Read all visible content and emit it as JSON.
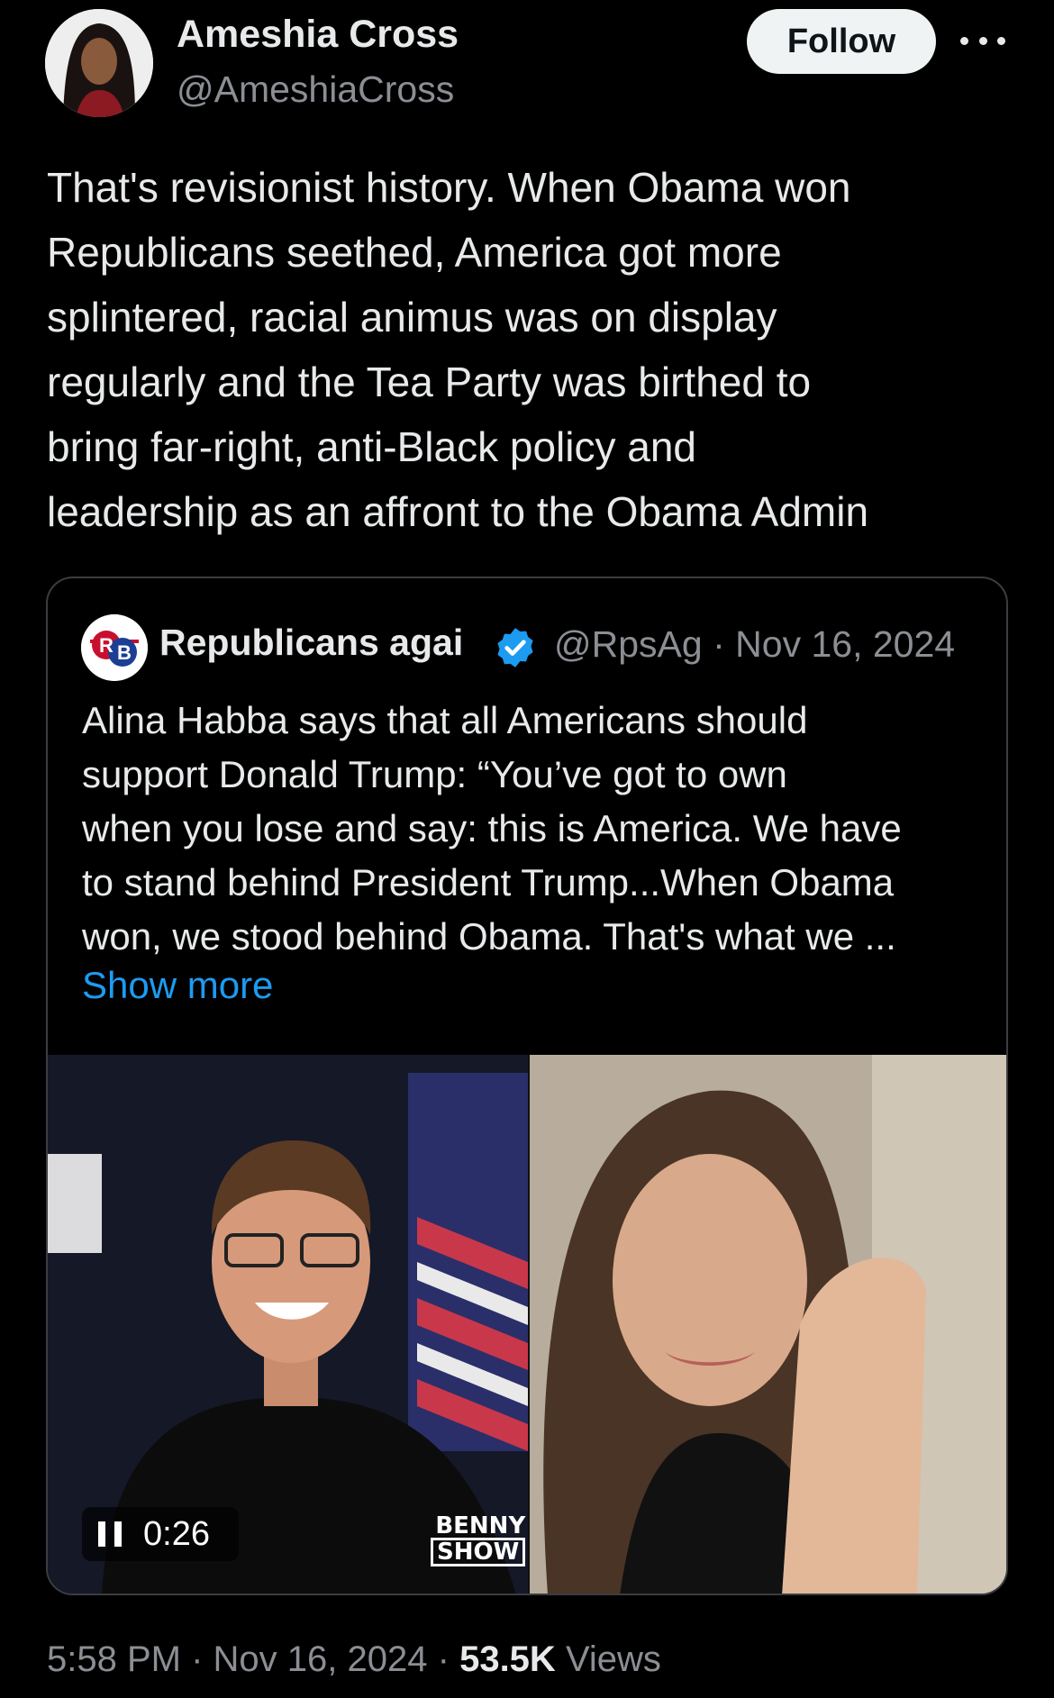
{
  "author": {
    "display_name": "Ameshia Cross",
    "handle": "@AmeshiaCross",
    "avatar_icon": "profile-photo"
  },
  "actions": {
    "follow_label": "Follow",
    "more_icon": "more-horizontal-icon"
  },
  "tweet": {
    "lines": [
      "That's revisionist history. When Obama won",
      "Republicans seethed, America got more",
      "splintered, racial animus was on display",
      "regularly and the Tea Party was birthed to",
      "bring far-right, anti-Black policy and",
      "leadership as an affront to the Obama Admin"
    ]
  },
  "quoted": {
    "display_name": "Republicans agai",
    "verified_icon": "verified-badge-icon",
    "handle": "@RpsAg",
    "separator": "·",
    "date": "Nov 16, 2024",
    "lines": [
      "Alina Habba says that all Americans should",
      "support Donald Trump: “You’ve got to own",
      "when you lose and say: this is America. We have",
      "to stand behind President Trump...When Obama",
      "won, we stood behind Obama. That's what we ..."
    ],
    "show_more_label": "Show more",
    "video": {
      "time": "0:26",
      "pause_icon": "pause-icon",
      "watermark_line1": "BENNY",
      "watermark_line2": "SHOW"
    }
  },
  "footer": {
    "time": "5:58 PM",
    "sep1": "·",
    "date": "Nov 16, 2024",
    "sep2": "·",
    "views_count": "53.5K",
    "views_label": "Views"
  },
  "colors": {
    "background": "#000000",
    "text_primary": "#e7e9ea",
    "text_secondary": "#8b8f94",
    "link": "#1d9bf0",
    "verified": "#1d9bf0",
    "card_border": "#3a3d41"
  }
}
